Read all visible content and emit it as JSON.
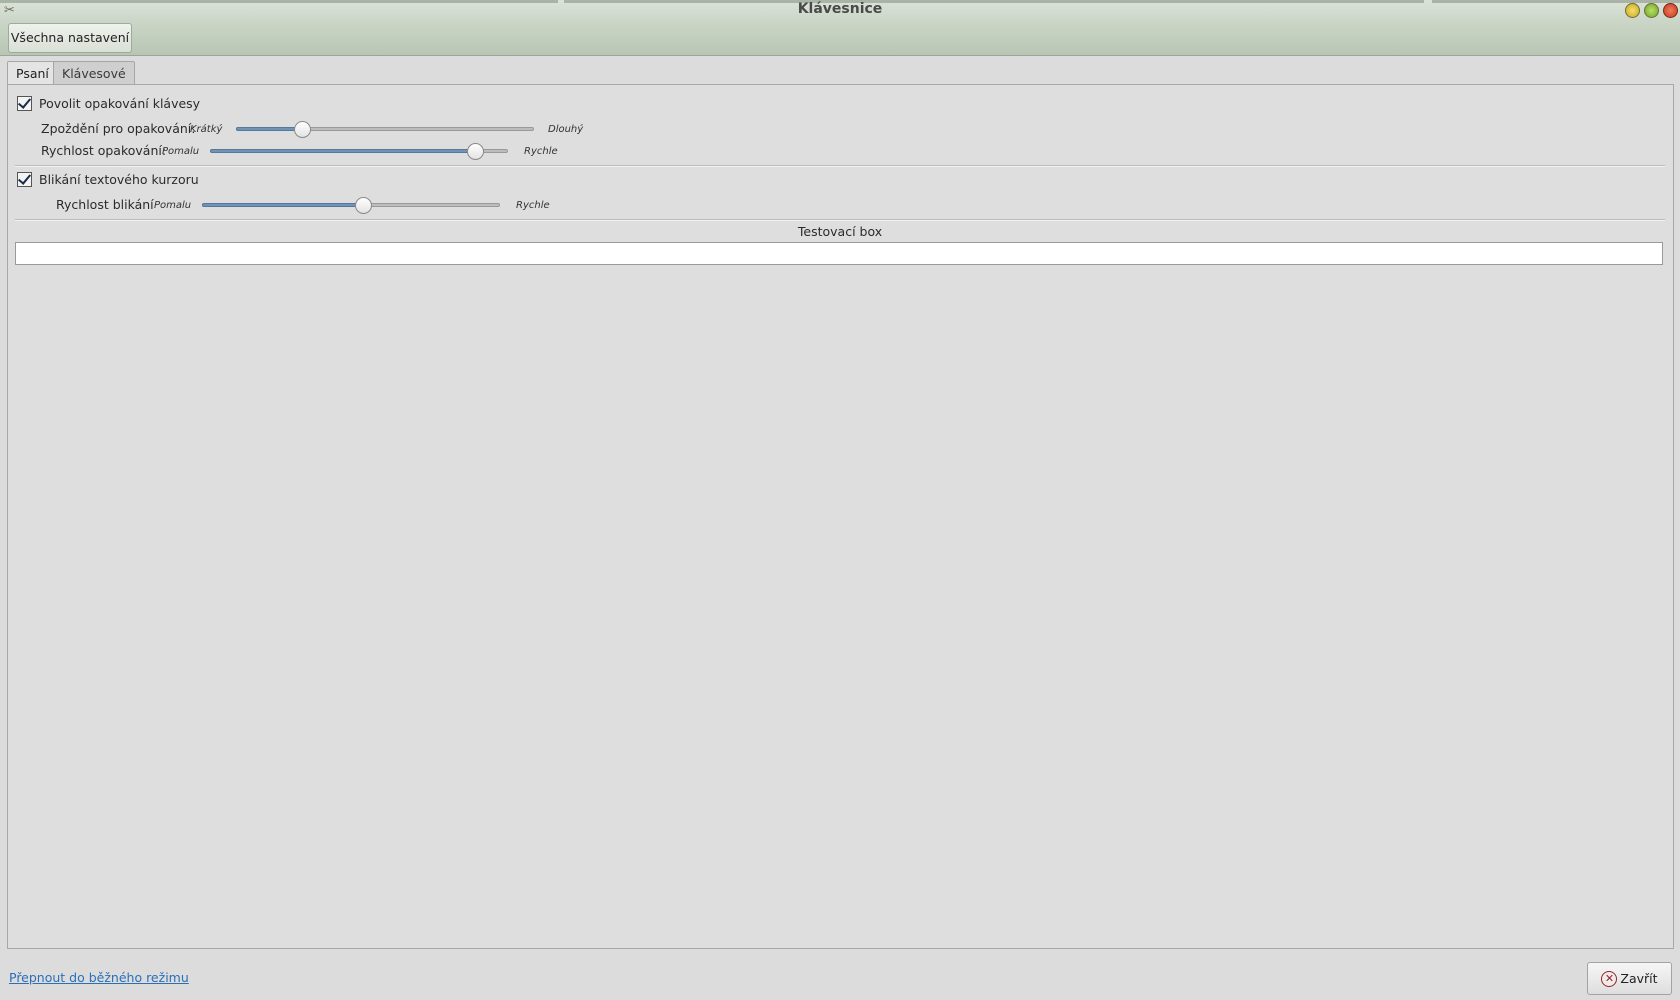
{
  "window": {
    "title": "Klávesnice",
    "icon": "tools-icon"
  },
  "toolbar": {
    "all_settings_label": "Všechna nastavení"
  },
  "tabs": [
    {
      "label": "Psaní",
      "active": true
    },
    {
      "label": "Klávesové zkratky",
      "active": false
    }
  ],
  "typing": {
    "repeat_enabled": {
      "label": "Povolit opakování klávesy",
      "checked": true
    },
    "repeat_delay": {
      "label": "Zpoždění pro opakování:",
      "min_label": "Krátký",
      "max_label": "Dlouhý",
      "value": 0.22
    },
    "repeat_speed": {
      "label": "Rychlost opakování:",
      "min_label": "Pomalu",
      "max_label": "Rychle",
      "value": 0.89
    },
    "cursor_blink": {
      "label": "Blikání textového kurzoru",
      "checked": true
    },
    "blink_speed": {
      "label": "Rychlost blikání",
      "min_label": "Pomalu",
      "max_label": "Rychle",
      "value": 0.54
    },
    "test_box": {
      "label": "Testovací box",
      "value": ""
    }
  },
  "footer": {
    "mode_link": "Přepnout do běžného režimu",
    "close_label": "Zavřít"
  },
  "colors": {
    "slider_fill": "#6f94b8",
    "link": "#2a6fb8",
    "titlebar": "#c9d4c5"
  }
}
